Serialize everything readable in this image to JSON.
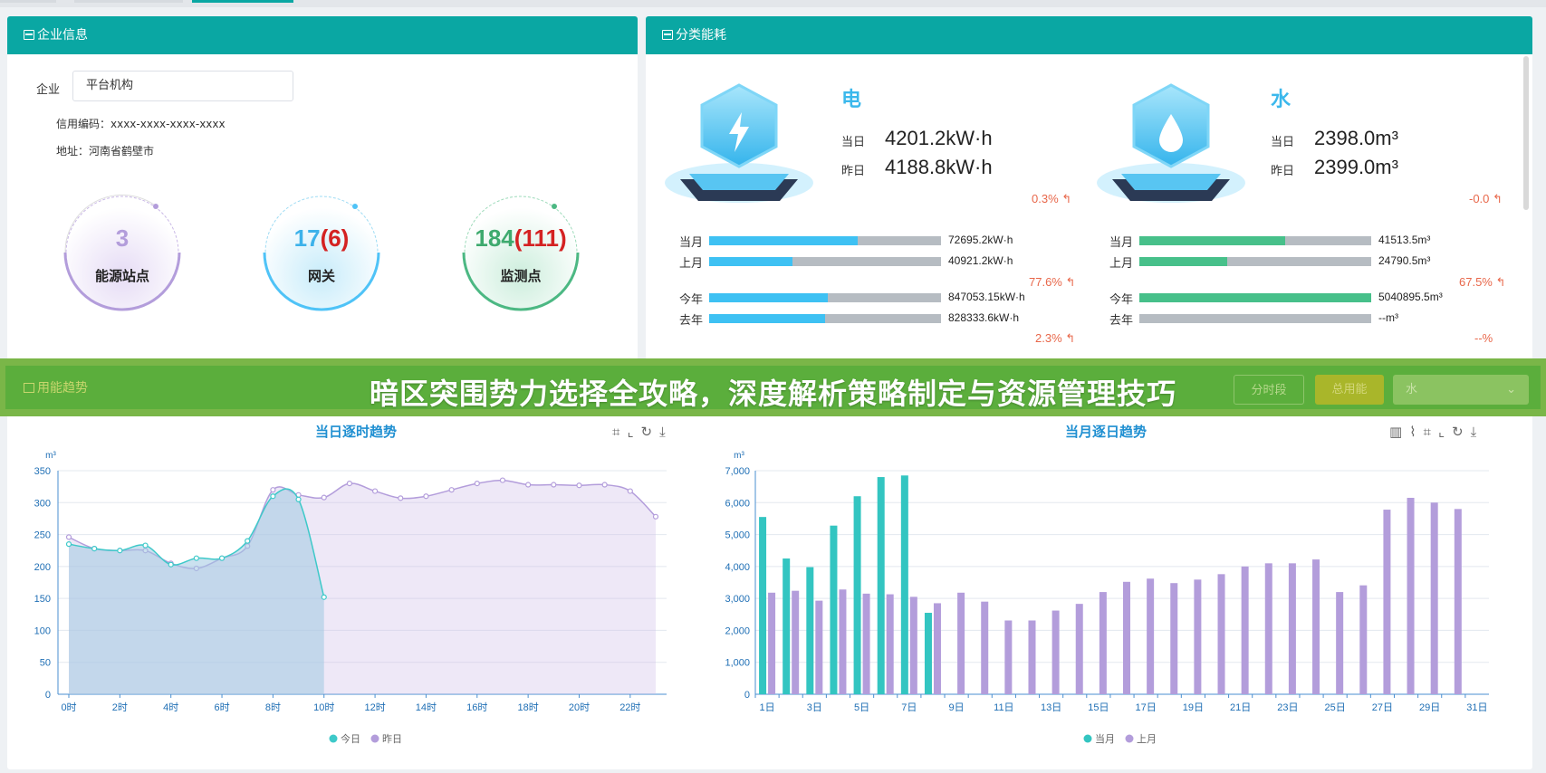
{
  "company_panel": {
    "title": "企业信息",
    "company_label": "企业",
    "company_value": "平台机构",
    "credit_code": "信用编码：xxxx-xxxx-xxxx-xxxx",
    "address": "地址：河南省鹤壁市",
    "stats": [
      {
        "value": "3",
        "extra": "",
        "label": "能源站点",
        "color": "#b39ddb"
      },
      {
        "value": "17",
        "extra": "(6)",
        "label": "网关",
        "color": "#4fc3f7"
      },
      {
        "value": "184",
        "extra": "(111)",
        "label": "监测点",
        "color": "#4cb883"
      }
    ]
  },
  "energy_panel": {
    "title": "分类能耗",
    "electric": {
      "name": "电",
      "today_label": "当日",
      "today_value": "4201.2kW·h",
      "yesterday_label": "昨日",
      "yesterday_value": "4188.8kW·h",
      "day_change": "0.3%",
      "rows": [
        {
          "label": "当月",
          "value": "72695.2kW·h",
          "fill": 0.64
        },
        {
          "label": "上月",
          "value": "40921.2kW·h",
          "fill": 0.36
        },
        {
          "label": "今年",
          "value": "847053.15kW·h",
          "fill": 0.51
        },
        {
          "label": "去年",
          "value": "828333.6kW·h",
          "fill": 0.5
        }
      ],
      "month_change": "77.6%",
      "year_change": "2.3%",
      "color": "#3ec1f3"
    },
    "water": {
      "name": "水",
      "today_label": "当日",
      "today_value": "2398.0m³",
      "yesterday_label": "昨日",
      "yesterday_value": "2399.0m³",
      "day_change": "-0.0",
      "rows": [
        {
          "label": "当月",
          "value": "41513.5m³",
          "fill": 0.63
        },
        {
          "label": "上月",
          "value": "24790.5m³",
          "fill": 0.38
        },
        {
          "label": "今年",
          "value": "5040895.5m³",
          "fill": 1.0
        },
        {
          "label": "去年",
          "value": "--m³",
          "fill": 0
        }
      ],
      "month_change": "67.5%",
      "year_change": "--%",
      "color": "#47c08a"
    }
  },
  "banner": {
    "headline": "暗区突围势力选择全攻略，深度解析策略制定与资源管理技巧",
    "section_title": "用能趋势",
    "btn_period": "分时段",
    "btn_total": "总用能",
    "select_value": "水"
  },
  "chart_data": [
    {
      "type": "line",
      "title": "当日逐时趋势",
      "ylabel": "m³",
      "ylim": [
        0,
        350
      ],
      "yticks": [
        0,
        50,
        100,
        150,
        200,
        250,
        300,
        350
      ],
      "xticks": [
        "0时",
        "2时",
        "4时",
        "6时",
        "8时",
        "10时",
        "12时",
        "14时",
        "16时",
        "18时",
        "20时",
        "22时"
      ],
      "series": [
        {
          "name": "今日",
          "color": "#3ec9c9",
          "x": [
            0,
            1,
            2,
            3,
            4,
            5,
            6,
            7,
            8,
            9,
            10
          ],
          "values": [
            235,
            228,
            225,
            233,
            203,
            213,
            213,
            240,
            310,
            305,
            152
          ]
        },
        {
          "name": "昨日",
          "color": "#b39ddb",
          "x": [
            0,
            1,
            2,
            3,
            4,
            5,
            6,
            7,
            8,
            9,
            10,
            11,
            12,
            13,
            14,
            15,
            16,
            17,
            18,
            19,
            20,
            21,
            22,
            23
          ],
          "values": [
            246,
            228,
            225,
            225,
            205,
            197,
            213,
            232,
            320,
            312,
            308,
            330,
            318,
            307,
            310,
            320,
            330,
            335,
            328,
            328,
            327,
            328,
            318,
            278
          ]
        }
      ]
    },
    {
      "type": "bar",
      "title": "当月逐日趋势",
      "ylabel": "m³",
      "ylim": [
        0,
        7000
      ],
      "yticks": [
        "0",
        "1,000",
        "2,000",
        "3,000",
        "4,000",
        "5,000",
        "6,000",
        "7,000"
      ],
      "xticks": [
        "1日",
        "3日",
        "5日",
        "7日",
        "9日",
        "11日",
        "13日",
        "15日",
        "17日",
        "19日",
        "21日",
        "23日",
        "25日",
        "27日",
        "29日",
        "31日"
      ],
      "series": [
        {
          "name": "当月",
          "color": "#33c5c1",
          "values": [
            5550,
            4250,
            3980,
            5280,
            6200,
            6800,
            6850,
            2550
          ]
        },
        {
          "name": "上月",
          "color": "#b39ddb",
          "values": [
            3180,
            3240,
            2930,
            3280,
            3150,
            3130,
            3050,
            2850,
            3180,
            2900,
            2310,
            2310,
            2620,
            2830,
            3200,
            3520,
            3620,
            3480,
            3590,
            3760,
            4000,
            4100,
            4100,
            4220,
            3200,
            3410,
            5780,
            6150,
            6000,
            5800
          ]
        }
      ]
    }
  ]
}
